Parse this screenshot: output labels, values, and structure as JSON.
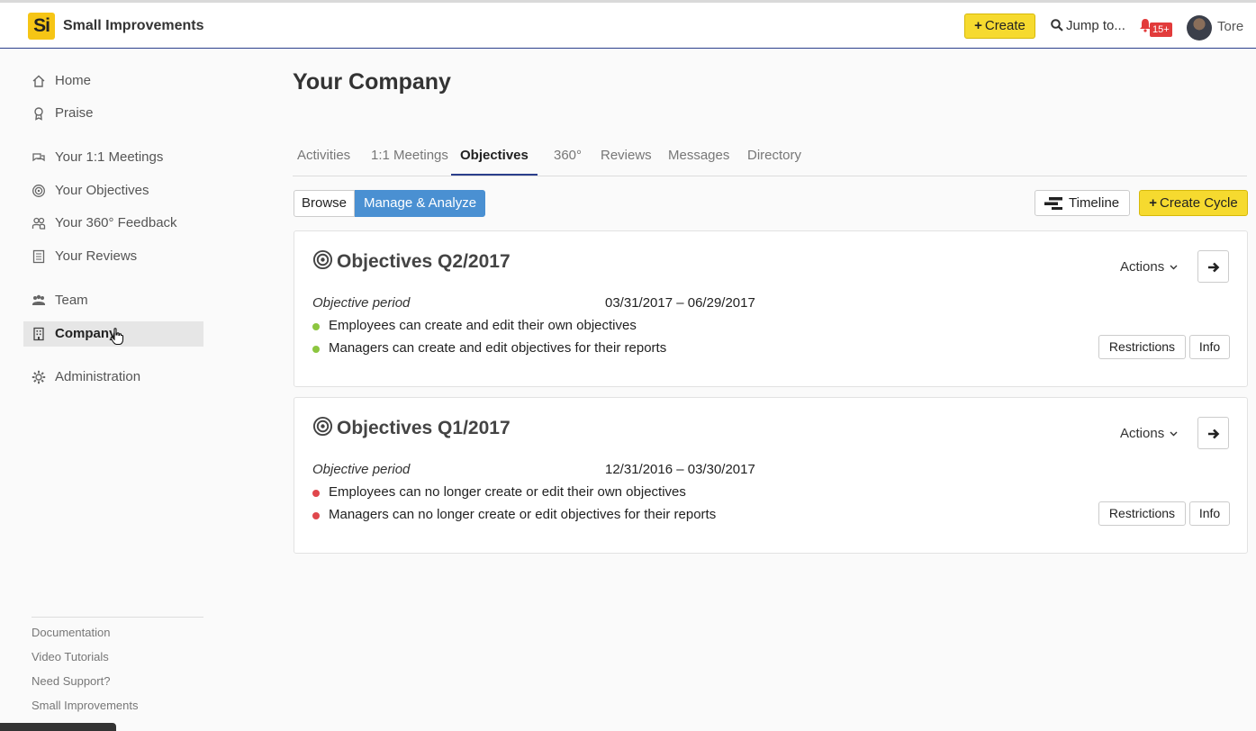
{
  "app": {
    "logo_text": "Si",
    "brand": "Small Improvements",
    "create_label": "Create",
    "jump_label": "Jump to...",
    "notification_count": "15+",
    "user_name": "Tore",
    "accent_color": "#2b3f8c",
    "create_color": "#f6da2f"
  },
  "sidebar": {
    "items": [
      {
        "label": "Home",
        "icon": "home-icon"
      },
      {
        "label": "Praise",
        "icon": "ribbon-icon"
      },
      {
        "label": "Your 1:1 Meetings",
        "icon": "chat-icon"
      },
      {
        "label": "Your Objectives",
        "icon": "target-icon"
      },
      {
        "label": "Your 360° Feedback",
        "icon": "people-icon"
      },
      {
        "label": "Your Reviews",
        "icon": "document-icon"
      },
      {
        "label": "Team",
        "icon": "team-icon"
      },
      {
        "label": "Company",
        "icon": "building-icon"
      },
      {
        "label": "Administration",
        "icon": "gear-icon"
      }
    ],
    "active": "Company",
    "footer": [
      "Documentation",
      "Video Tutorials",
      "Need Support?",
      "Small Improvements"
    ]
  },
  "main": {
    "title": "Your Company",
    "tabs": [
      "Activities",
      "1:1 Meetings",
      "Objectives",
      "360°",
      "Reviews",
      "Messages",
      "Directory"
    ],
    "active_tab": "Objectives",
    "view_toggle": {
      "browse": "Browse",
      "manage": "Manage & Analyze",
      "selected": "Manage & Analyze"
    },
    "timeline_label": "Timeline",
    "create_cycle_label": "Create Cycle",
    "cycles": [
      {
        "title": "Objectives Q2/2017",
        "actions_label": "Actions",
        "period_label": "Objective period",
        "period": "03/31/2017 – 06/29/2017",
        "rules": [
          {
            "text": "Employees can create and edit their own objectives",
            "status": "open"
          },
          {
            "text": "Managers can create and edit objectives for their reports",
            "status": "open"
          }
        ],
        "restrictions_label": "Restrictions",
        "info_label": "Info"
      },
      {
        "title": "Objectives Q1/2017",
        "actions_label": "Actions",
        "period_label": "Objective period",
        "period": "12/31/2016 – 03/30/2017",
        "rules": [
          {
            "text": "Employees can no longer create or edit their own objectives",
            "status": "closed"
          },
          {
            "text": "Managers can no longer create or edit objectives for their reports",
            "status": "closed"
          }
        ],
        "restrictions_label": "Restrictions",
        "info_label": "Info"
      }
    ],
    "status_colors": {
      "open": "#8cc63f",
      "closed": "#e0474c"
    }
  }
}
